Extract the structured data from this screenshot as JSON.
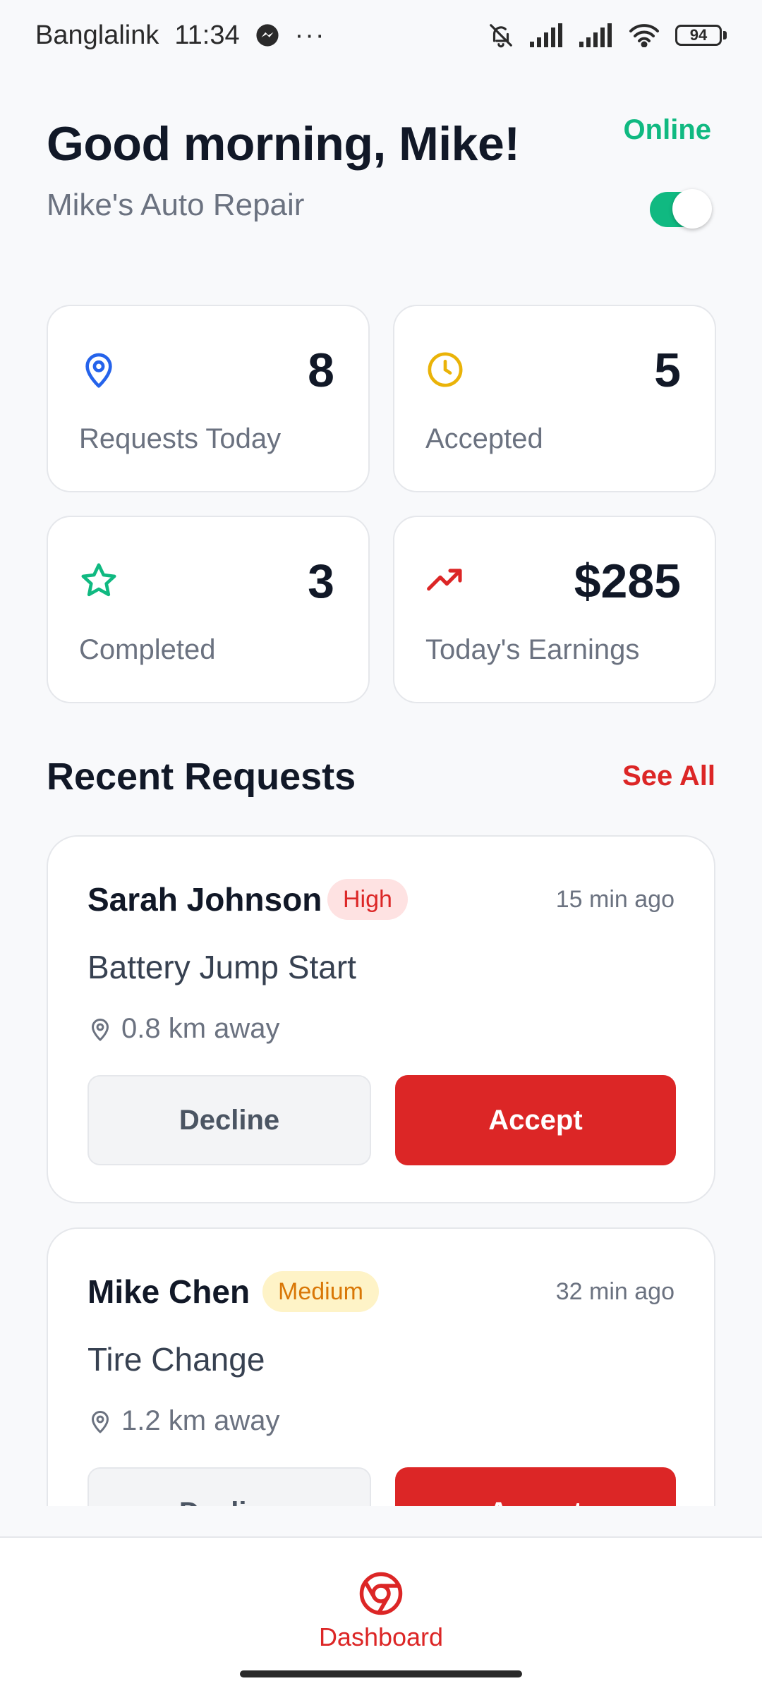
{
  "status_bar": {
    "carrier": "Banglalink",
    "time": "11:34",
    "battery": "94"
  },
  "header": {
    "greeting": "Good morning, Mike!",
    "business_name": "Mike's Auto Repair",
    "status_label": "Online",
    "online_toggle": true
  },
  "stats": [
    {
      "value": "8",
      "label": "Requests Today",
      "icon": "map-pin-icon",
      "color": "#2563eb"
    },
    {
      "value": "5",
      "label": "Accepted",
      "icon": "clock-icon",
      "color": "#eab308"
    },
    {
      "value": "3",
      "label": "Completed",
      "icon": "star-icon",
      "color": "#10b981"
    },
    {
      "value": "$285",
      "label": "Today's Earnings",
      "icon": "trending-up-icon",
      "color": "#dc2626"
    }
  ],
  "recent": {
    "title": "Recent Requests",
    "see_all": "See All"
  },
  "requests": [
    {
      "name": "Sarah Johnson",
      "priority": "High",
      "time": "15 min ago",
      "service": "Battery Jump Start",
      "distance": "0.8 km away",
      "decline_label": "Decline",
      "accept_label": "Accept"
    },
    {
      "name": "Mike Chen",
      "priority": "Medium",
      "time": "32 min ago",
      "service": "Tire Change",
      "distance": "1.2 km away",
      "decline_label": "Decline",
      "accept_label": "Accept"
    }
  ],
  "nav": {
    "dashboard_label": "Dashboard"
  },
  "colors": {
    "accent": "#dc2626",
    "online": "#10b981",
    "high_badge_bg": "#fee2e2",
    "high_badge_text": "#dc2626",
    "medium_badge_bg": "#fef3c7",
    "medium_badge_text": "#d97706"
  }
}
